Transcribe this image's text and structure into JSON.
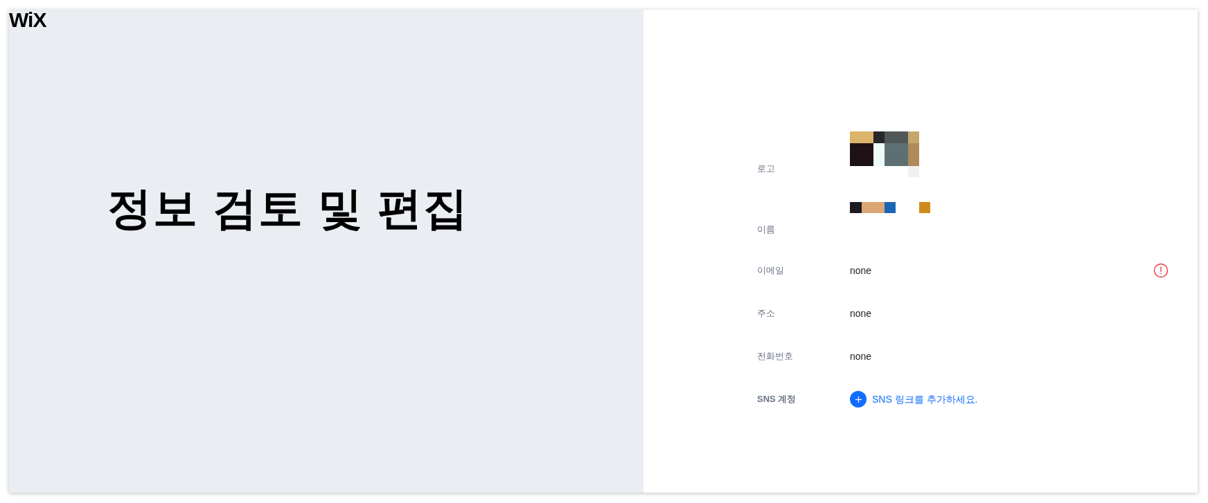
{
  "brand": "WiX",
  "heading": "정보 검토 및 편집",
  "fields": [
    {
      "label": "로고",
      "kind": "logo-picture"
    },
    {
      "label": "이름",
      "kind": "name-picture"
    },
    {
      "label": "이메일",
      "kind": "text",
      "value": "none",
      "error": true
    },
    {
      "label": "주소",
      "kind": "text",
      "value": "none",
      "error": false
    },
    {
      "label": "전화번호",
      "kind": "text",
      "value": "none",
      "error": false
    },
    {
      "label": "SNS 계정",
      "kind": "link",
      "value": "SNS 링크를 추가하세요."
    }
  ]
}
